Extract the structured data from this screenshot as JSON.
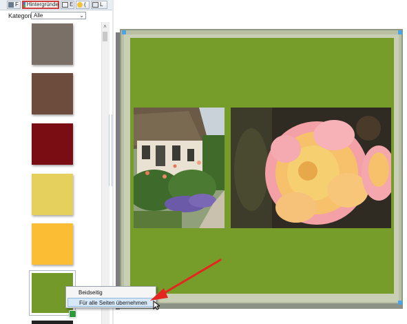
{
  "tabs": [
    {
      "label": "F",
      "icon": "image-icon"
    },
    {
      "label": "Hintergründe",
      "icon": "background-icon",
      "active": true
    },
    {
      "label": "E",
      "icon": "frame-icon"
    },
    {
      "label": "(",
      "icon": "smiley-icon"
    },
    {
      "label": "L",
      "icon": "layout-icon"
    }
  ],
  "category": {
    "label": "Kategorie:",
    "selected": "Alle"
  },
  "swatches": [
    "#7b7068",
    "#6d4b3d",
    "#7a0d13",
    "#e5cf5d",
    "#fbbd33",
    "#73992a"
  ],
  "selected_swatch_color": "#73992a",
  "page_background_color": "#769d2a",
  "context_menu": {
    "items": [
      "Beidseitig",
      "Für alle Seiten übernehmen"
    ],
    "highlighted_index": 1
  },
  "colors": {
    "arrow": "#e52620",
    "accent": "#d23a3a"
  }
}
